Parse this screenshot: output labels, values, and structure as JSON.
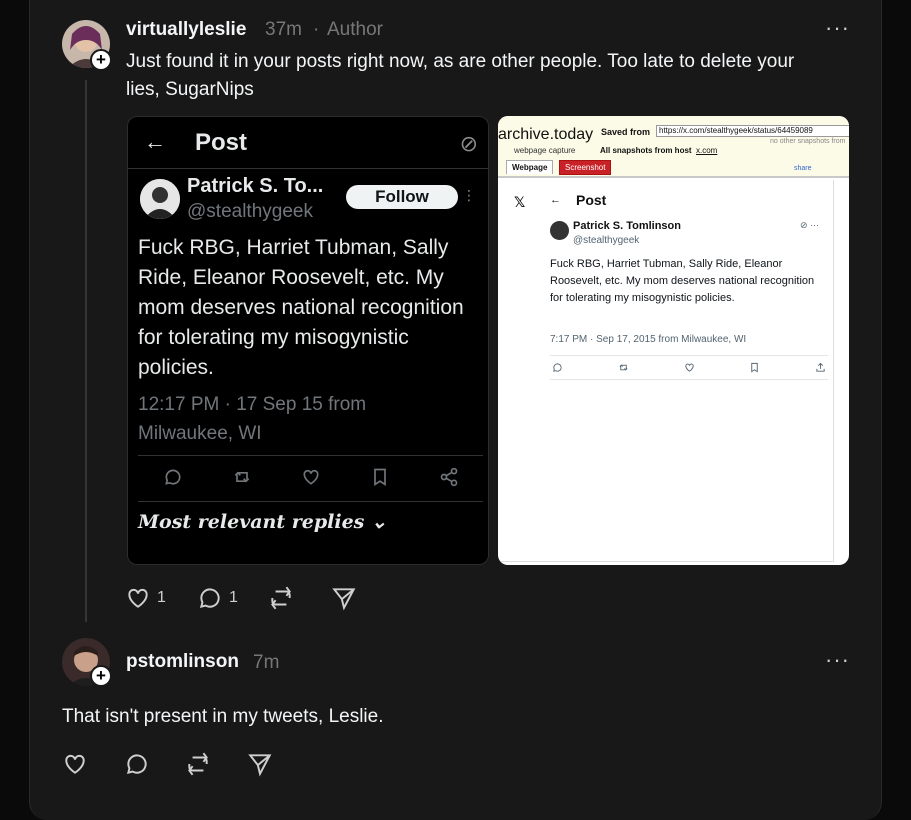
{
  "colors": {
    "background": "#181818",
    "text": "#f3f5f7",
    "muted": "#777777",
    "archive_red": "#c82127"
  },
  "post1": {
    "username": "virtuallyleslie",
    "time": "37m",
    "separator": "·",
    "author_badge": "Author",
    "more": "···",
    "text": "Just found it in your posts right now, as are other people. Too late to delete your lies, SugarNips",
    "likes": "1",
    "comments": "1"
  },
  "image_left": {
    "back": "←",
    "title": "Post",
    "name": "Patrick S. To...",
    "handle": "@stealthygeek",
    "follow": "Follow",
    "body": "Fuck RBG, Harriet Tubman, Sally Ride, Eleanor Roosevelt, etc. My mom deserves national recognition for tolerating my misogynistic policies.",
    "timestamp": "12:17 PM · 17 Sep 15 from Milwaukee, WI",
    "replies": "Most relevant replies ⌄"
  },
  "image_right": {
    "logo": "archive.today",
    "saved_from": "Saved from",
    "url": "https://x.com/stealthygeek/status/64459089",
    "other_snapshots": "no other snapshots from",
    "webpage_capture": "webpage capture",
    "all_snapshots": "All snapshots from host",
    "host": "x.com",
    "tab_webpage": "Webpage",
    "tab_screenshot": "Screenshot",
    "share": "share",
    "x_logo": "𝕏",
    "back": "←",
    "title": "Post",
    "name": "Patrick S. Tomlinson",
    "handle": "@stealthygeek",
    "body": "Fuck RBG, Harriet Tubman, Sally Ride, Eleanor Roosevelt, etc. My mom deserves national recognition for tolerating my misogynistic policies.",
    "timestamp": "7:17 PM · Sep 17, 2015 from Milwaukee, WI"
  },
  "post2": {
    "username": "pstomlinson",
    "time": "7m",
    "more": "···",
    "text": "That isn't present in my tweets, Leslie."
  }
}
